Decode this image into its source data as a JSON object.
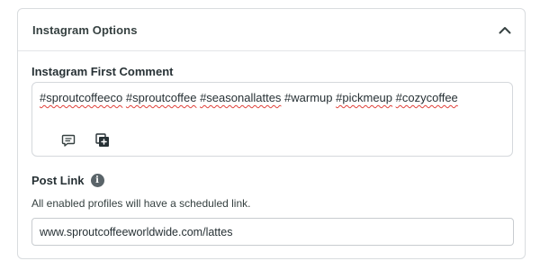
{
  "panel": {
    "title": "Instagram Options",
    "toggle_icon": "chevron-up-icon"
  },
  "first_comment": {
    "label": "Instagram First Comment",
    "hashtags": [
      {
        "text": "#sproutcoffeeco",
        "misspelled": true
      },
      {
        "text": "#sproutcoffee",
        "misspelled": true
      },
      {
        "text": "#seasonallattes",
        "misspelled": true
      },
      {
        "text": "#warmup",
        "misspelled": false
      },
      {
        "text": "#pickmeup",
        "misspelled": true
      },
      {
        "text": "#cozycoffee",
        "misspelled": true
      }
    ],
    "tools": [
      {
        "icon": "comment-icon"
      },
      {
        "icon": "add-media-icon"
      }
    ]
  },
  "post_link": {
    "label": "Post Link",
    "info_icon": "info-icon",
    "helper": "All enabled profiles will have a scheduled link.",
    "value": "www.sproutcoffeeworldwide.com/lattes"
  },
  "colors": {
    "border": "#d9dcdf",
    "text": "#273135",
    "spellcheck_underline": "#e0413a",
    "icon": "#364141"
  }
}
